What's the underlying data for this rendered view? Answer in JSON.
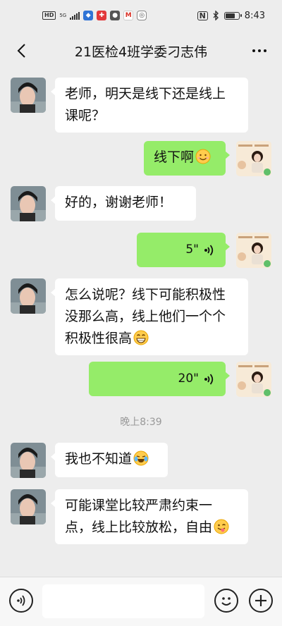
{
  "status_bar": {
    "network_hd": "HD",
    "network_gen": "5G",
    "time": "8:43",
    "battery_level": 0.75,
    "icons": [
      "hd-icon",
      "signal-icon",
      "app-notify-icon",
      "message-icon",
      "mail-icon",
      "nfc-icon",
      "bluetooth-icon",
      "battery-icon"
    ]
  },
  "nav": {
    "title": "21医检4班学委刁志伟",
    "back_icon": "chevron-left-icon",
    "more_icon": "more-dots-icon"
  },
  "messages": [
    {
      "type": "text",
      "side": "left",
      "text": "老师，明天是线下还是线上课呢？"
    },
    {
      "type": "text",
      "side": "right",
      "text": "线下啊",
      "emoji": "smile-emoji"
    },
    {
      "type": "text",
      "side": "left",
      "text": "好的，谢谢老师！"
    },
    {
      "type": "voice",
      "side": "right",
      "duration": "5\""
    },
    {
      "type": "text",
      "side": "left",
      "text": "怎么说呢？线下可能积极性没那么高，线上他们一个个积极性很高",
      "emoji": "grin-emoji"
    },
    {
      "type": "voice",
      "side": "right",
      "duration": "20\""
    },
    {
      "type": "time",
      "text": "晚上8:39"
    },
    {
      "type": "text",
      "side": "left",
      "text": "我也不知道",
      "emoji": "laugh-cry-emoji"
    },
    {
      "type": "text",
      "side": "left",
      "text": "可能课堂比较严肃约束一点，线上比较放松，自由",
      "emoji": "wink-tongue-emoji"
    }
  ],
  "toolbar": {
    "voice_icon": "voice-mode-icon",
    "input_value": "",
    "emoji_icon": "emoji-icon",
    "plus_icon": "plus-icon"
  },
  "colors": {
    "background": "#ededed",
    "sent_bubble": "#95ec69",
    "received_bubble": "#ffffff"
  }
}
